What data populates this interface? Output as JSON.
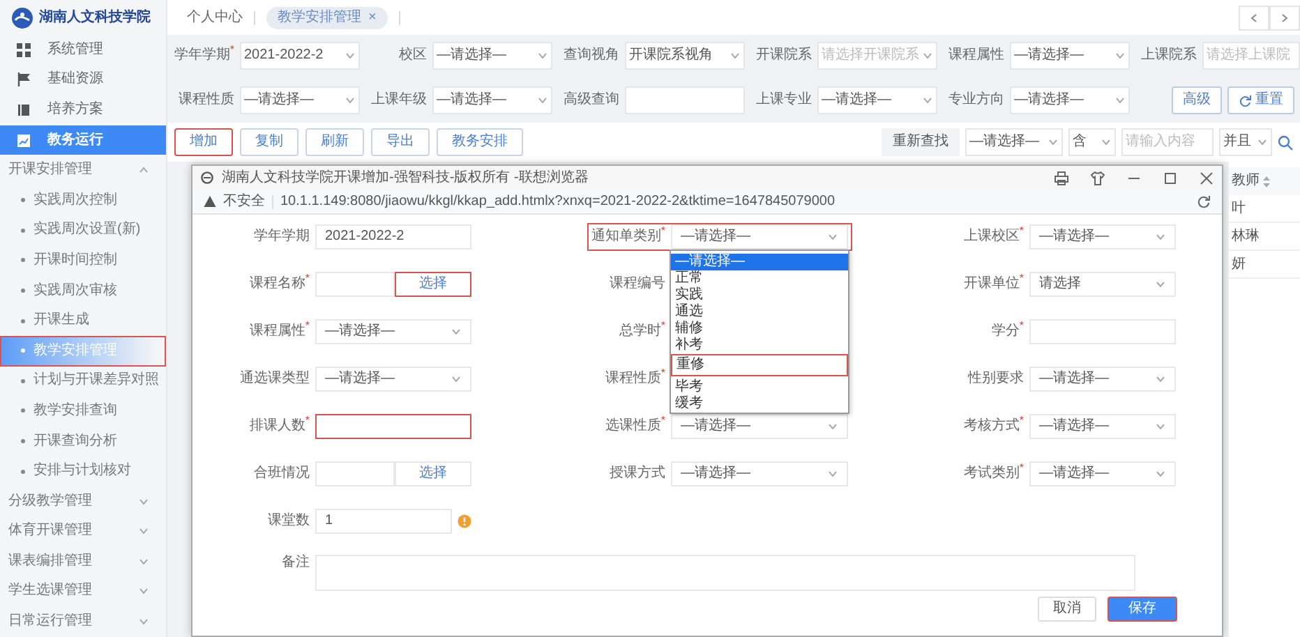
{
  "sidebar": {
    "logo": "湖南人文科技学院",
    "modules": [
      {
        "label": "系统管理",
        "selected": false
      },
      {
        "label": "基础资源",
        "selected": false
      },
      {
        "label": "培养方案",
        "selected": false
      },
      {
        "label": "教务运行",
        "selected": true
      }
    ],
    "groups": [
      {
        "label": "开课安排管理",
        "expanded": true,
        "children": [
          {
            "label": "实践周次控制",
            "selected": false,
            "highlighted": false
          },
          {
            "label": "实践周次设置(新)",
            "selected": false,
            "highlighted": false
          },
          {
            "label": "开课时间控制",
            "selected": false,
            "highlighted": false
          },
          {
            "label": "实践周次审核",
            "selected": false,
            "highlighted": false
          },
          {
            "label": "开课生成",
            "selected": false,
            "highlighted": false
          },
          {
            "label": "教学安排管理",
            "selected": true,
            "highlighted": true
          },
          {
            "label": "计划与开课差异对照",
            "selected": false,
            "highlighted": false
          },
          {
            "label": "教学安排查询",
            "selected": false,
            "highlighted": false
          },
          {
            "label": "开课查询分析",
            "selected": false,
            "highlighted": false
          },
          {
            "label": "安排与计划核对",
            "selected": false,
            "highlighted": false
          }
        ]
      },
      {
        "label": "分级教学管理",
        "expanded": false
      },
      {
        "label": "体育开课管理",
        "expanded": false
      },
      {
        "label": "课表编排管理",
        "expanded": false
      },
      {
        "label": "学生选课管理",
        "expanded": false
      },
      {
        "label": "日常运行管理",
        "expanded": false
      }
    ]
  },
  "tabs": {
    "home": "个人中心",
    "items": [
      {
        "label": "教学安排管理",
        "close": "×",
        "selected": true
      }
    ]
  },
  "filters": {
    "rows": [
      [
        {
          "label": "学年学期$^{*}$",
          "kind": "select",
          "value": "2021-2022-2"
        },
        {
          "label": "校区",
          "kind": "select",
          "value": "—请选择—"
        },
        {
          "label": "查询视角",
          "kind": "select",
          "value": "开课院系视角"
        },
        {
          "label": "开课院系",
          "kind": "select",
          "placeholder": "请选择开课院系"
        },
        {
          "label": "课程属性",
          "kind": "select",
          "value": "—请选择—"
        },
        {
          "label": "上课院系",
          "kind": "input",
          "placeholder": "请选择上课院"
        }
      ],
      [
        {
          "label": "课程性质",
          "kind": "select",
          "value": "—请选择—"
        },
        {
          "label": "上课年级",
          "kind": "select",
          "value": "—请选择—"
        },
        {
          "label": "高级查询",
          "kind": "input"
        },
        {
          "label": "上课专业",
          "kind": "select",
          "value": "—请选择—"
        },
        {
          "label": "专业方向",
          "kind": "select",
          "value": "—请选择—"
        }
      ]
    ],
    "buttons": [
      {
        "label": "高级",
        "kind": "plain"
      },
      {
        "label": "重置",
        "kind": "reset"
      }
    ]
  },
  "toolbar": {
    "buttons": [
      {
        "label": "增加",
        "highlighted": true
      },
      {
        "label": "复制",
        "highlighted": false
      },
      {
        "label": "刷新",
        "highlighted": false
      },
      {
        "label": "导出",
        "highlighted": false
      },
      {
        "label": "教务安排",
        "highlighted": false
      }
    ],
    "search": {
      "label": "重新查找",
      "field": "—请选择—",
      "operator": "含",
      "placeholder": "请输入内容",
      "logic": "并且"
    }
  },
  "dialog": {
    "title": "湖南人文科技学院开课增加-强智科技-版权所有 -联想浏览器",
    "address": {
      "warning": "不安全",
      "url": "10.1.1.149:8080/jiaowu/kkgl/kkap_add.htmlx?xnxq=2021-2022-2&tktime=1647845079000"
    },
    "rows": [
      [
        {
          "label": "学年学期",
          "kind": "input",
          "value": "2021-2022-2",
          "highlighted": false
        },
        {
          "label": "通知单类别$^{*}$",
          "kind": "select",
          "value": "—请选择—",
          "highlighted": true,
          "options": [
            {
              "label": "—请选择—",
              "selected": true,
              "highlighted": false
            },
            {
              "label": "正常",
              "selected": false,
              "highlighted": false
            },
            {
              "label": "实践",
              "selected": false,
              "highlighted": false
            },
            {
              "label": "通选",
              "selected": false,
              "highlighted": false
            },
            {
              "label": "辅修",
              "selected": false,
              "highlighted": false
            },
            {
              "label": "补考",
              "selected": false,
              "highlighted": false
            },
            {
              "label": "重修",
              "selected": false,
              "highlighted": true
            },
            {
              "label": "毕考",
              "selected": false,
              "highlighted": false
            },
            {
              "label": "缓考",
              "selected": false,
              "highlighted": false
            }
          ]
        },
        {
          "label": "上课校区$^{*}$",
          "kind": "select",
          "value": "—请选择—",
          "highlighted": false
        }
      ],
      [
        {
          "label": "课程名称$^{*}$",
          "kind": "input_button",
          "button": {
            "label": "选择",
            "highlighted": true
          }
        },
        {
          "label": "课程编号",
          "kind": "covered"
        },
        {
          "label": "开课单位$^{*}$",
          "kind": "select",
          "value": "请选择",
          "highlighted": false
        }
      ],
      [
        {
          "label": "课程属性$^{*}$",
          "kind": "select",
          "value": "—请选择—",
          "highlighted": false
        },
        {
          "label": "总学时$^{*}$",
          "kind": "covered"
        },
        {
          "label": "学分$^{*}$",
          "kind": "input",
          "highlighted": false
        }
      ],
      [
        {
          "label": "通选课类型",
          "kind": "select",
          "value": "—请选择—",
          "highlighted": false
        },
        {
          "label": "课程性质$^{*}$",
          "kind": "covered"
        },
        {
          "label": "性别要求",
          "kind": "select",
          "value": "—请选择—",
          "highlighted": false
        }
      ],
      [
        {
          "label": "排课人数$^{*}$",
          "kind": "input",
          "highlighted": true
        },
        {
          "label": "选课性质$^{*}$",
          "kind": "select",
          "value": "—请选择—",
          "highlighted": false
        },
        {
          "label": "考核方式$^{*}$",
          "kind": "select",
          "value": "—请选择—",
          "highlighted": false
        }
      ],
      [
        {
          "label": "合班情况",
          "kind": "input_button",
          "button": {
            "label": "选择",
            "highlighted": false
          }
        },
        {
          "label": "授课方式",
          "kind": "select",
          "value": "—请选择—",
          "highlighted": false
        },
        {
          "label": "考试类别$^{*}$",
          "kind": "select",
          "value": "—请选择—",
          "highlighted": false
        }
      ],
      [
        {
          "label": "课堂数",
          "kind": "input_info",
          "value": "1",
          "highlighted": false
        }
      ],
      [
        {
          "label": "备注",
          "kind": "textarea",
          "highlighted": false
        }
      ]
    ],
    "buttons": [
      {
        "label": "取消",
        "kind": "default",
        "highlighted": false
      },
      {
        "label": "保存",
        "kind": "primary",
        "highlighted": true
      }
    ]
  },
  "background_table": {
    "column": "教师",
    "cells": [
      "叶",
      "林琳",
      "妍"
    ]
  }
}
